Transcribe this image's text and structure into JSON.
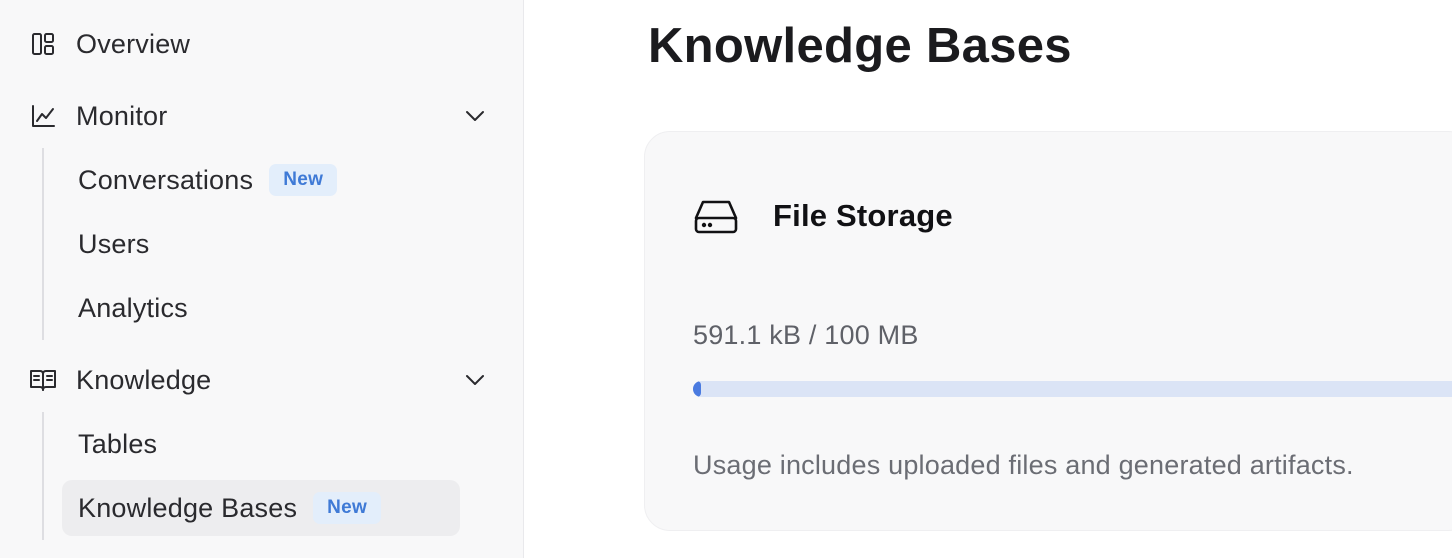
{
  "sidebar": {
    "overview": {
      "label": "Overview",
      "icon": "layout-icon"
    },
    "monitor": {
      "label": "Monitor",
      "icon": "line-chart-icon",
      "items": [
        {
          "label": "Conversations",
          "badge": "New"
        },
        {
          "label": "Users"
        },
        {
          "label": "Analytics"
        }
      ]
    },
    "knowledge": {
      "label": "Knowledge",
      "icon": "book-open-icon",
      "items": [
        {
          "label": "Tables"
        },
        {
          "label": "Knowledge Bases",
          "badge": "New",
          "active": true
        }
      ]
    }
  },
  "main": {
    "title": "Knowledge Bases",
    "storage_card": {
      "title": "File Storage",
      "icon": "hard-drive-icon",
      "usage": "591.1 kB / 100 MB",
      "usage_fraction": 0.006,
      "note": "Usage includes uploaded files and generated artifacts."
    }
  },
  "colors": {
    "accent": "#4b7be0",
    "badge_bg": "#e3eefb",
    "badge_text": "#3f7ad6"
  }
}
